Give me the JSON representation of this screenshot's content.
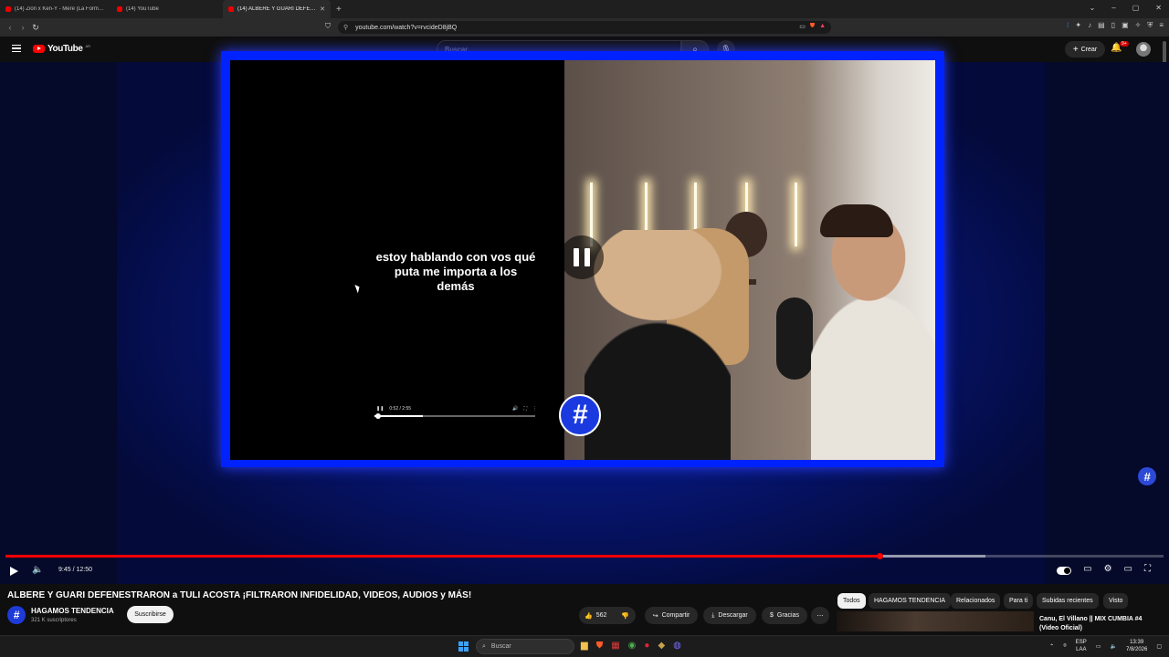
{
  "browser": {
    "tabs": [
      {
        "title": "(14) Zion x Ken-Y - Mere (La Formula)"
      },
      {
        "title": "(14) YouTube"
      },
      {
        "title": "(14) ALBERE Y GUARI DEFENESTRARON"
      }
    ],
    "url": "youtube.com/watch?v=rvcideD8jBQ"
  },
  "header": {
    "logo_text": "YouTube",
    "country_code": "AR",
    "search_placeholder": "Buscar",
    "create_label": "Crear",
    "notification_count": "9+"
  },
  "video": {
    "caption": "estoy hablando con vos qué puta me importa a los demás",
    "inner_time": "0:52 / 2:55",
    "channel_mark": "#",
    "progress_fraction": 0.755,
    "buffer_fraction": 0.846
  },
  "player": {
    "time": "9:45 / 12:50"
  },
  "meta": {
    "title": "ALBERE Y GUARI DEFENESTRARON a TULI ACOSTA ¡FILTRARON INFIDELIDAD, VIDEOS, AUDIOS y MÁS!",
    "channel_name": "HAGAMOS TENDENCIA",
    "subscribers": "321 K suscriptores",
    "subscribe_label": "Suscribirse",
    "likes": "562",
    "share_label": "Compartir",
    "download_label": "Descargar",
    "thanks_label": "Gracias"
  },
  "chips": [
    "Todos",
    "HAGAMOS TENDENCIA",
    "Relacionados",
    "Para ti",
    "Subidas recientes",
    "Visto"
  ],
  "recommended": {
    "title": "Canu, El Villano || MIX CUMBIA #4 (Video Oficial)"
  },
  "taskbar": {
    "search_placeholder": "Buscar",
    "lang_line1": "ESP",
    "lang_line2": "LAA",
    "time": "13:39",
    "date": "7/8/2026"
  }
}
